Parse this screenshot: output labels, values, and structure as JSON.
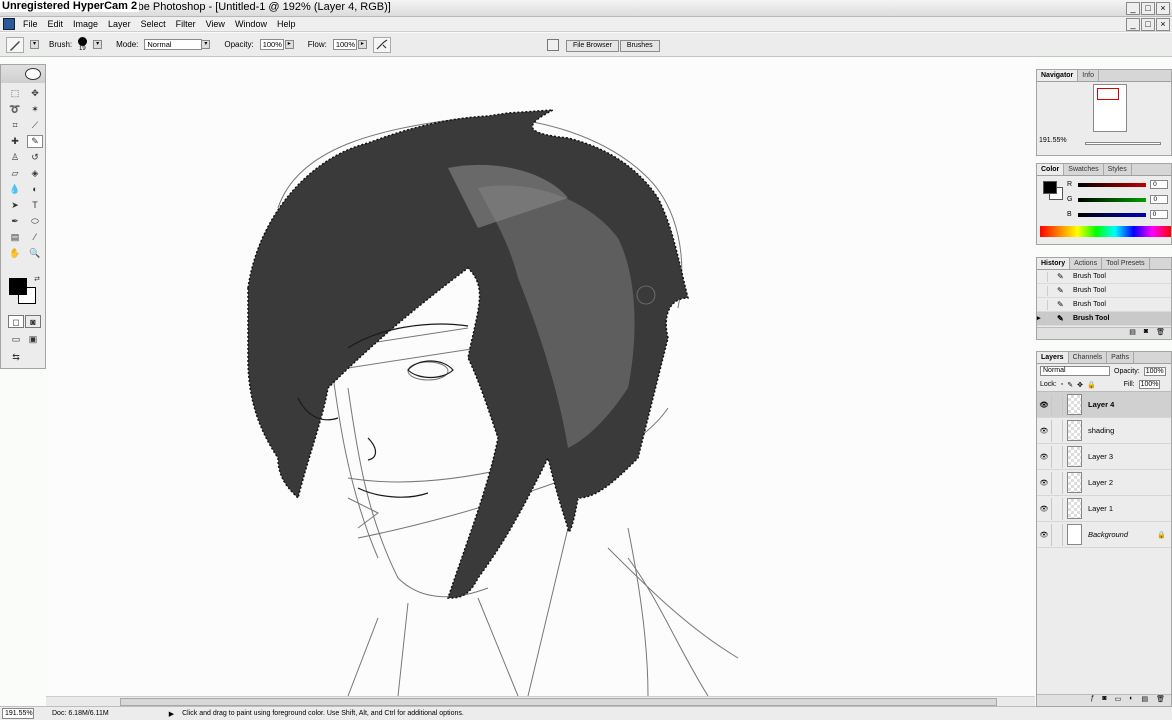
{
  "window": {
    "hypercam_label": "Unregistered HyperCam 2",
    "title": "Adobe Photoshop - [Untitled-1 @ 192% (Layer 4, RGB)]",
    "controls": [
      "_",
      "□",
      "×"
    ]
  },
  "menu": [
    "File",
    "Edit",
    "Image",
    "Layer",
    "Select",
    "Filter",
    "View",
    "Window",
    "Help"
  ],
  "options": {
    "brush_label": "Brush:",
    "brush_size": "19",
    "mode_label": "Mode:",
    "mode_value": "Normal",
    "opacity_label": "Opacity:",
    "opacity_value": "100%",
    "flow_label": "Flow:",
    "flow_value": "100%"
  },
  "well_tabs": [
    "File Browser",
    "Brushes"
  ],
  "navigator": {
    "tabs": [
      "Navigator",
      "Info"
    ],
    "zoom": "191.55%"
  },
  "color": {
    "tabs": [
      "Color",
      "Swatches",
      "Styles"
    ],
    "channels": [
      {
        "name": "R",
        "value": "0",
        "color": "#c00000"
      },
      {
        "name": "G",
        "value": "0",
        "color": "#00a000"
      },
      {
        "name": "B",
        "value": "0",
        "color": "#0000c0"
      }
    ]
  },
  "history": {
    "tabs": [
      "History",
      "Actions",
      "Tool Presets"
    ],
    "items": [
      "Brush Tool",
      "Brush Tool",
      "Brush Tool",
      "Brush Tool"
    ],
    "active_index": 3
  },
  "layers": {
    "tabs": [
      "Layers",
      "Channels",
      "Paths"
    ],
    "blend_mode": "Normal",
    "opacity_label": "Opacity:",
    "opacity_value": "100%",
    "lock_label": "Lock:",
    "fill_label": "Fill:",
    "fill_value": "100%",
    "items": [
      {
        "name": "Layer 4",
        "active": true
      },
      {
        "name": "shading",
        "active": false
      },
      {
        "name": "Layer 3",
        "active": false
      },
      {
        "name": "Layer 2",
        "active": false
      },
      {
        "name": "Layer 1",
        "active": false
      },
      {
        "name": "Background",
        "active": false
      }
    ]
  },
  "status": {
    "zoom": "191.55%",
    "doc": "Doc: 6.18M/6.11M",
    "hint": "Click and drag to paint using foreground color. Use Shift, Alt, and Ctrl for additional options."
  },
  "colors": {
    "foreground": "#000000",
    "background": "#ffffff"
  }
}
